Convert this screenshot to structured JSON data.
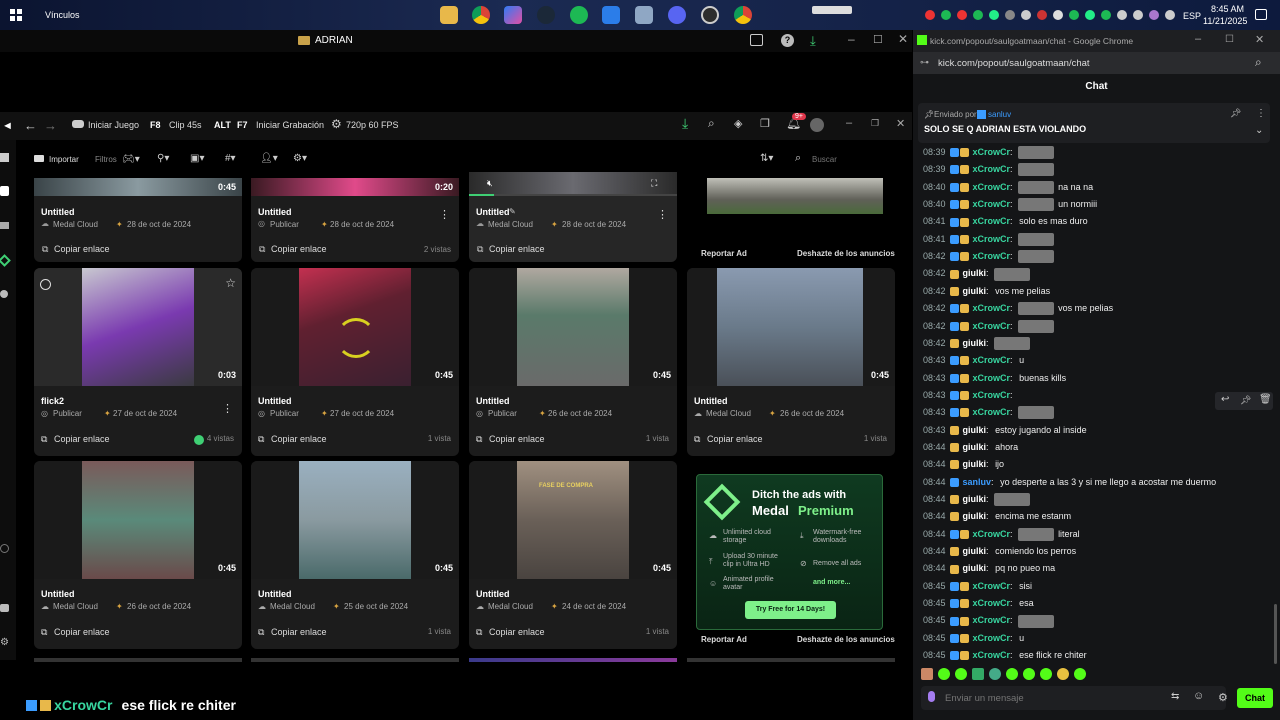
{
  "taskbar": {
    "folder_label": "Vínculos",
    "lang": "ESP",
    "time": "8:45 AM",
    "date": "11/21/2025"
  },
  "medal": {
    "window_title": "ADRIAN",
    "toolbar": {
      "start_game": "Iniciar Juego",
      "clip_key": "F8",
      "clip_label": "Clip 45s",
      "rec_key": "ALT",
      "rec_key2": "F7",
      "rec_label": "Iniciar Grabación",
      "quality": "720p 60 FPS",
      "notif": "9+"
    },
    "filters": {
      "import": "Importar",
      "filters": "Filtros",
      "search_placeholder": "Buscar"
    },
    "top_cards": [
      {
        "title": "Untitled",
        "dur": "0:45",
        "privacy": "Medal Cloud",
        "date": "28 de oct de 2024",
        "link": "Copiar enlace",
        "views": ""
      },
      {
        "title": "Untitled",
        "dur": "0:20",
        "privacy": "Publicar",
        "date": "28 de oct de 2024",
        "link": "Copiar enlace",
        "views": "2 vistas"
      },
      {
        "title": "Untitled",
        "dur": "",
        "privacy": "Medal Cloud",
        "date": "28 de oct de 2024",
        "link": "Copiar enlace",
        "views": ""
      }
    ],
    "ad_top": {
      "report": "Reportar Ad",
      "remove": "Deshazte de los anuncios"
    },
    "row2": [
      {
        "title": "flick2",
        "dur": "0:03",
        "privacy": "Publicar",
        "date": "27 de oct de 2024",
        "link": "Copiar enlace",
        "views": "4 vistas"
      },
      {
        "title": "Untitled",
        "dur": "0:45",
        "privacy": "Publicar",
        "date": "27 de oct de 2024",
        "link": "Copiar enlace",
        "views": "1 vista"
      },
      {
        "title": "Untitled",
        "dur": "0:45",
        "privacy": "Publicar",
        "date": "26 de oct de 2024",
        "link": "Copiar enlace",
        "views": "1 vista"
      },
      {
        "title": "Untitled",
        "dur": "0:45",
        "privacy": "Medal Cloud",
        "date": "26 de oct de 2024",
        "link": "Copiar enlace",
        "views": "1 vista"
      }
    ],
    "row3": [
      {
        "title": "Untitled",
        "dur": "0:45",
        "privacy": "Medal Cloud",
        "date": "26 de oct de 2024",
        "link": "Copiar enlace",
        "views": ""
      },
      {
        "title": "Untitled",
        "dur": "0:45",
        "privacy": "Medal Cloud",
        "date": "25 de oct de 2024",
        "link": "Copiar enlace",
        "views": "1 vista"
      },
      {
        "title": "Untitled",
        "dur": "0:45",
        "privacy": "Medal Cloud",
        "date": "24 de oct de 2024",
        "link": "Copiar enlace",
        "views": "1 vista"
      }
    ],
    "row3_thumb3_text": "FASE DE COMPRA",
    "ad": {
      "title1": "Ditch the ads with",
      "title2": "Medal ",
      "title3": "Premium",
      "f1": "Unlimited cloud storage",
      "f2": "Watermark-free downloads",
      "f3": "Upload 30 minute clip in Ultra HD",
      "f4": "Remove all ads",
      "f5": "Animated profile avatar",
      "f6": "and more...",
      "cta": "Try Free for 14 Days!",
      "report": "Reportar Ad",
      "remove": "Deshazte de los anuncios"
    },
    "overlay": {
      "user": "xCrowCr",
      "text": "ese flick re chiter"
    }
  },
  "chat": {
    "window_title": "kick.com/popout/saulgoatmaan/chat - Google Chrome",
    "url": "kick.com/popout/saulgoatmaan/chat",
    "header": "Chat",
    "pinned_by_label": "Enviado por",
    "pinned_by": "sanluv",
    "pinned_text": "SOLO SE Q ADRIAN ESTA VIOLANDO",
    "input_placeholder": "Enviar un mensaje",
    "send": "Chat",
    "colors": {
      "xcrow": "#38d6a0",
      "giulki": "#ffffff",
      "sanluv": "#3b9cff"
    },
    "messages": [
      {
        "t": "08:39",
        "u": "xCrowCr",
        "x": "",
        "e": true
      },
      {
        "t": "08:39",
        "u": "xCrowCr",
        "x": "",
        "e": true
      },
      {
        "t": "08:40",
        "u": "xCrowCr",
        "x": "na na na",
        "e": true
      },
      {
        "t": "08:40",
        "u": "xCrowCr",
        "x": "un normiii",
        "e": true
      },
      {
        "t": "08:41",
        "u": "xCrowCr",
        "x": "solo es mas duro",
        "e": false
      },
      {
        "t": "08:41",
        "u": "xCrowCr",
        "x": "",
        "e": true
      },
      {
        "t": "08:42",
        "u": "xCrowCr",
        "x": "",
        "e": true
      },
      {
        "t": "08:42",
        "u": "giulki",
        "x": "",
        "e": true
      },
      {
        "t": "08:42",
        "u": "giulki",
        "x": "vos me pelias",
        "e": false
      },
      {
        "t": "08:42",
        "u": "xCrowCr",
        "x": "vos me pelias",
        "e": true
      },
      {
        "t": "08:42",
        "u": "xCrowCr",
        "x": "",
        "e": true
      },
      {
        "t": "08:42",
        "u": "giulki",
        "x": "",
        "e": true
      },
      {
        "t": "08:43",
        "u": "xCrowCr",
        "x": "u",
        "e": false
      },
      {
        "t": "08:43",
        "u": "xCrowCr",
        "x": "buenas kills",
        "e": false
      },
      {
        "t": "08:43",
        "u": "xCrowCr",
        "x": "",
        "e": false
      },
      {
        "t": "08:43",
        "u": "xCrowCr",
        "x": "",
        "e": true
      },
      {
        "t": "08:43",
        "u": "giulki",
        "x": "estoy jugando al inside",
        "e": false
      },
      {
        "t": "08:44",
        "u": "giulki",
        "x": "ahora",
        "e": false
      },
      {
        "t": "08:44",
        "u": "giulki",
        "x": "ijo",
        "e": false
      },
      {
        "t": "08:44",
        "u": "sanluv",
        "x": "yo desperte a las 3 y si me llego a acostar me duermo",
        "e": false
      },
      {
        "t": "08:44",
        "u": "giulki",
        "x": "",
        "e": true
      },
      {
        "t": "08:44",
        "u": "giulki",
        "x": "encima me estanm",
        "e": false
      },
      {
        "t": "08:44",
        "u": "xCrowCr",
        "x": "literal",
        "e": true
      },
      {
        "t": "08:44",
        "u": "giulki",
        "x": "comiendo los perros",
        "e": false
      },
      {
        "t": "08:44",
        "u": "giulki",
        "x": "pq no pueo ma",
        "e": false
      },
      {
        "t": "08:45",
        "u": "xCrowCr",
        "x": "sisi",
        "e": false
      },
      {
        "t": "08:45",
        "u": "xCrowCr",
        "x": "esa",
        "e": false
      },
      {
        "t": "08:45",
        "u": "xCrowCr",
        "x": "",
        "e": true
      },
      {
        "t": "08:45",
        "u": "xCrowCr",
        "x": "u",
        "e": false
      },
      {
        "t": "08:45",
        "u": "xCrowCr",
        "x": "ese flick re chiter",
        "e": false
      }
    ]
  }
}
